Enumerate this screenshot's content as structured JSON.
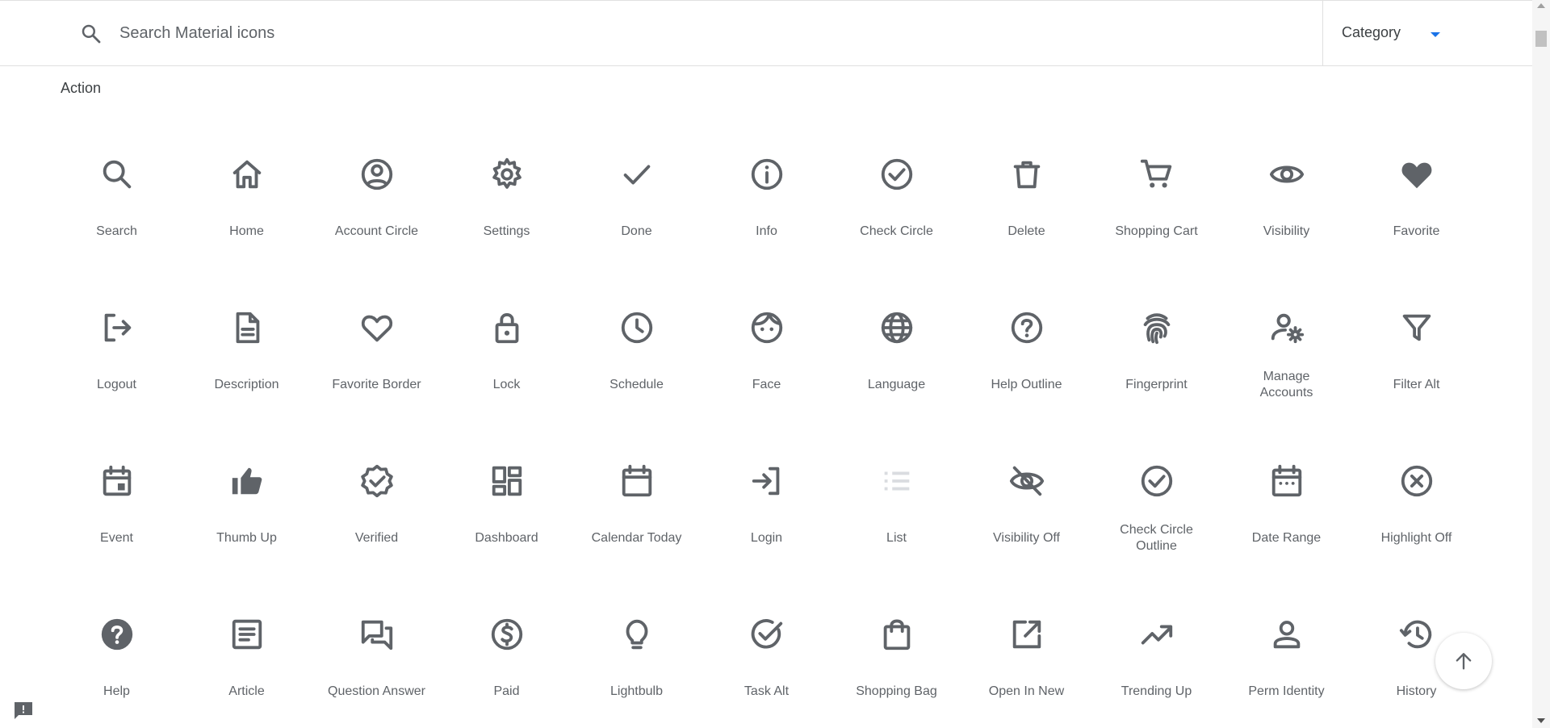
{
  "search": {
    "placeholder": "Search Material icons"
  },
  "category": {
    "label": "Category"
  },
  "section": {
    "title": "Action"
  },
  "icons": [
    {
      "label": "Search",
      "icon": "search-icon"
    },
    {
      "label": "Home",
      "icon": "home-icon"
    },
    {
      "label": "Account Circle",
      "icon": "account-circle-icon"
    },
    {
      "label": "Settings",
      "icon": "settings-icon"
    },
    {
      "label": "Done",
      "icon": "done-icon"
    },
    {
      "label": "Info",
      "icon": "info-icon"
    },
    {
      "label": "Check Circle",
      "icon": "check-circle-icon"
    },
    {
      "label": "Delete",
      "icon": "delete-icon"
    },
    {
      "label": "Shopping Cart",
      "icon": "shopping-cart-icon"
    },
    {
      "label": "Visibility",
      "icon": "visibility-icon"
    },
    {
      "label": "Favorite",
      "icon": "favorite-icon"
    },
    {
      "label": "Logout",
      "icon": "logout-icon"
    },
    {
      "label": "Description",
      "icon": "description-icon"
    },
    {
      "label": "Favorite Border",
      "icon": "favorite-border-icon"
    },
    {
      "label": "Lock",
      "icon": "lock-icon"
    },
    {
      "label": "Schedule",
      "icon": "schedule-icon"
    },
    {
      "label": "Face",
      "icon": "face-icon"
    },
    {
      "label": "Language",
      "icon": "language-icon"
    },
    {
      "label": "Help Outline",
      "icon": "help-outline-icon"
    },
    {
      "label": "Fingerprint",
      "icon": "fingerprint-icon"
    },
    {
      "label": "Manage Accounts",
      "icon": "manage-accounts-icon"
    },
    {
      "label": "Filter Alt",
      "icon": "filter-alt-icon"
    },
    {
      "label": "Event",
      "icon": "event-icon"
    },
    {
      "label": "Thumb Up",
      "icon": "thumb-up-icon"
    },
    {
      "label": "Verified",
      "icon": "verified-icon"
    },
    {
      "label": "Dashboard",
      "icon": "dashboard-icon"
    },
    {
      "label": "Calendar Today",
      "icon": "calendar-today-icon"
    },
    {
      "label": "Login",
      "icon": "login-icon"
    },
    {
      "label": "List",
      "icon": "list-icon"
    },
    {
      "label": "Visibility Off",
      "icon": "visibility-off-icon"
    },
    {
      "label": "Check Circle Outline",
      "icon": "check-circle-outline-icon"
    },
    {
      "label": "Date Range",
      "icon": "date-range-icon"
    },
    {
      "label": "Highlight Off",
      "icon": "highlight-off-icon"
    },
    {
      "label": "Help",
      "icon": "help-icon"
    },
    {
      "label": "Article",
      "icon": "article-icon"
    },
    {
      "label": "Question Answer",
      "icon": "question-answer-icon"
    },
    {
      "label": "Paid",
      "icon": "paid-icon"
    },
    {
      "label": "Lightbulb",
      "icon": "lightbulb-icon"
    },
    {
      "label": "Task Alt",
      "icon": "task-alt-icon"
    },
    {
      "label": "Shopping Bag",
      "icon": "shopping-bag-icon"
    },
    {
      "label": "Open In New",
      "icon": "open-in-new-icon"
    },
    {
      "label": "Trending Up",
      "icon": "trending-up-icon"
    },
    {
      "label": "Perm Identity",
      "icon": "perm-identity-icon"
    },
    {
      "label": "History",
      "icon": "history-icon"
    }
  ],
  "colors": {
    "icon": "#5f6368",
    "accent": "#1a73e8",
    "border": "#e0e0e0",
    "faded_icon": "#dadce0"
  },
  "fab": {
    "icon": "arrow-upward-icon"
  },
  "feedback": {
    "icon": "feedback-icon"
  }
}
